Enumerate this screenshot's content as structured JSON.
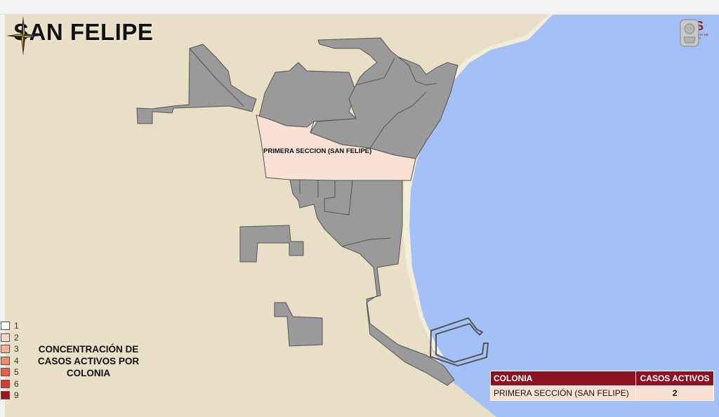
{
  "map": {
    "title": "SAN FELIPE",
    "highlight_label": "PRIMERA SECCION (SAN FELIPE)",
    "colors": {
      "land": "#e8dfc6",
      "sea": "#a3c1f6",
      "colonia_gray": "#9a9a9a",
      "highlight": "#fbe0d4"
    }
  },
  "legend": {
    "title": "CONCENTRACIÓN DE CASOS ACTIVOS POR COLONIA",
    "items": [
      {
        "value": "1",
        "color": "#ffffff"
      },
      {
        "value": "2",
        "color": "#fbd9c9"
      },
      {
        "value": "3",
        "color": "#f5b19a"
      },
      {
        "value": "4",
        "color": "#ee8a6f"
      },
      {
        "value": "5",
        "color": "#e55f4b"
      },
      {
        "value": "6",
        "color": "#d63a33"
      },
      {
        "value": "9",
        "color": "#a11220"
      }
    ]
  },
  "logo": {
    "abbr": "SS",
    "subtitle": "SECRETARÍA DE SALUD",
    "icon": "seal-icon"
  },
  "table": {
    "headers": [
      "COLONIA",
      "CASOS ACTIVOS"
    ],
    "rows": [
      {
        "colonia": "PRIMERA SECCIÓN (SAN FELIPE)",
        "casos": "2"
      }
    ],
    "header_color": "#8a1224",
    "row_color": "#fbe0d4"
  },
  "compass": {
    "icon": "compass-rose-icon"
  }
}
